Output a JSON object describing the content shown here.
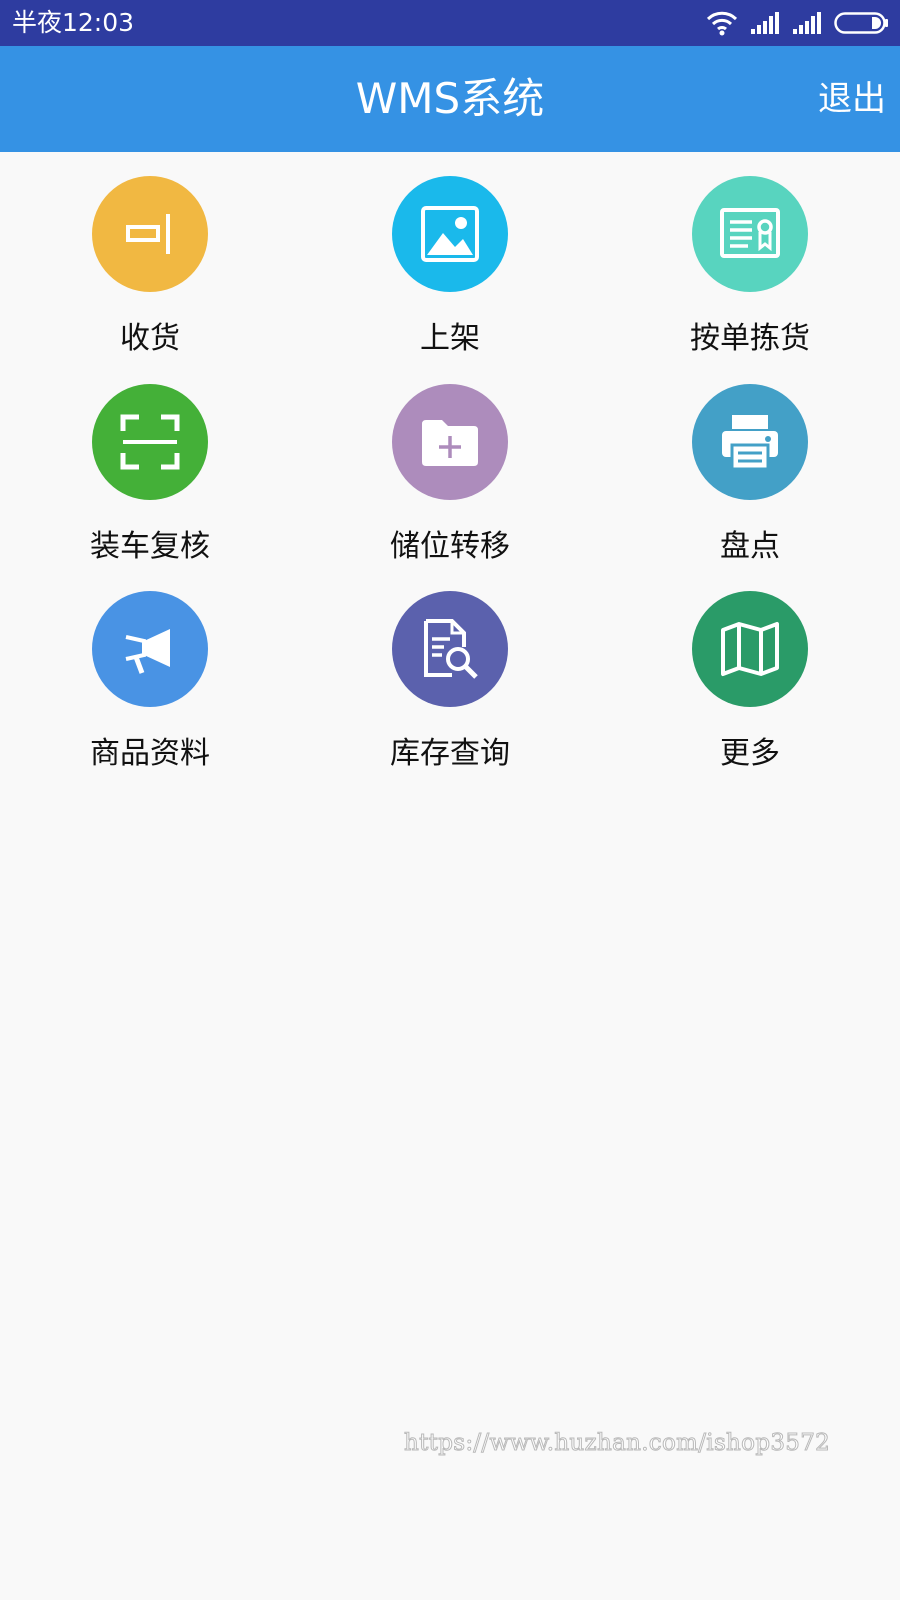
{
  "status_bar": {
    "time": "半夜12:03",
    "icons": [
      "wifi-icon",
      "signal-icon",
      "signal-icon",
      "battery-icon"
    ]
  },
  "header": {
    "title": "WMS系统",
    "logout_label": "退出"
  },
  "menu": {
    "items": [
      {
        "label": "收货",
        "icon": "receive-icon",
        "color": "#f1b842"
      },
      {
        "label": "上架",
        "icon": "image-icon",
        "color": "#1ab9eb"
      },
      {
        "label": "按单拣货",
        "icon": "certificate-icon",
        "color": "#58d4bf"
      },
      {
        "label": "装车复核",
        "icon": "scan-icon",
        "color": "#44b038"
      },
      {
        "label": "储位转移",
        "icon": "folder-add-icon",
        "color": "#ad8cbc"
      },
      {
        "label": "盘点",
        "icon": "printer-icon",
        "color": "#43a0c7"
      },
      {
        "label": "商品资料",
        "icon": "megaphone-icon",
        "color": "#4993e4"
      },
      {
        "label": "库存查询",
        "icon": "document-search-icon",
        "color": "#5b61ad"
      },
      {
        "label": "更多",
        "icon": "map-icon",
        "color": "#2a9b68"
      }
    ]
  },
  "watermark": "https://www.huzhan.com/ishop3572"
}
